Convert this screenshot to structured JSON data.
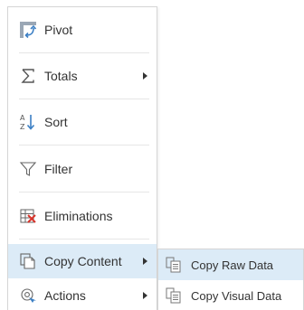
{
  "menu": {
    "items": [
      {
        "label": "Pivot",
        "icon": "pivot-icon",
        "has_submenu": false
      },
      {
        "label": "Totals",
        "icon": "sigma-icon",
        "has_submenu": true
      },
      {
        "label": "Sort",
        "icon": "sort-az-icon",
        "has_submenu": false
      },
      {
        "label": "Filter",
        "icon": "filter-funnel-icon",
        "has_submenu": false
      },
      {
        "label": "Eliminations",
        "icon": "eliminations-grid-icon",
        "has_submenu": false
      },
      {
        "label": "Copy Content",
        "icon": "copy-document-icon",
        "has_submenu": true,
        "active": true
      },
      {
        "label": "Actions",
        "icon": "actions-gear-icon",
        "has_submenu": true
      }
    ]
  },
  "submenu": {
    "items": [
      {
        "label": "Copy Raw Data",
        "icon": "copy-raw-data-icon",
        "active": true
      },
      {
        "label": "Copy Visual Data",
        "icon": "copy-visual-data-icon",
        "active": false
      }
    ]
  },
  "colors": {
    "highlight": "#dcebf7",
    "accent_blue": "#3b7fc4",
    "text": "#333333",
    "border": "#d6d6d6"
  }
}
